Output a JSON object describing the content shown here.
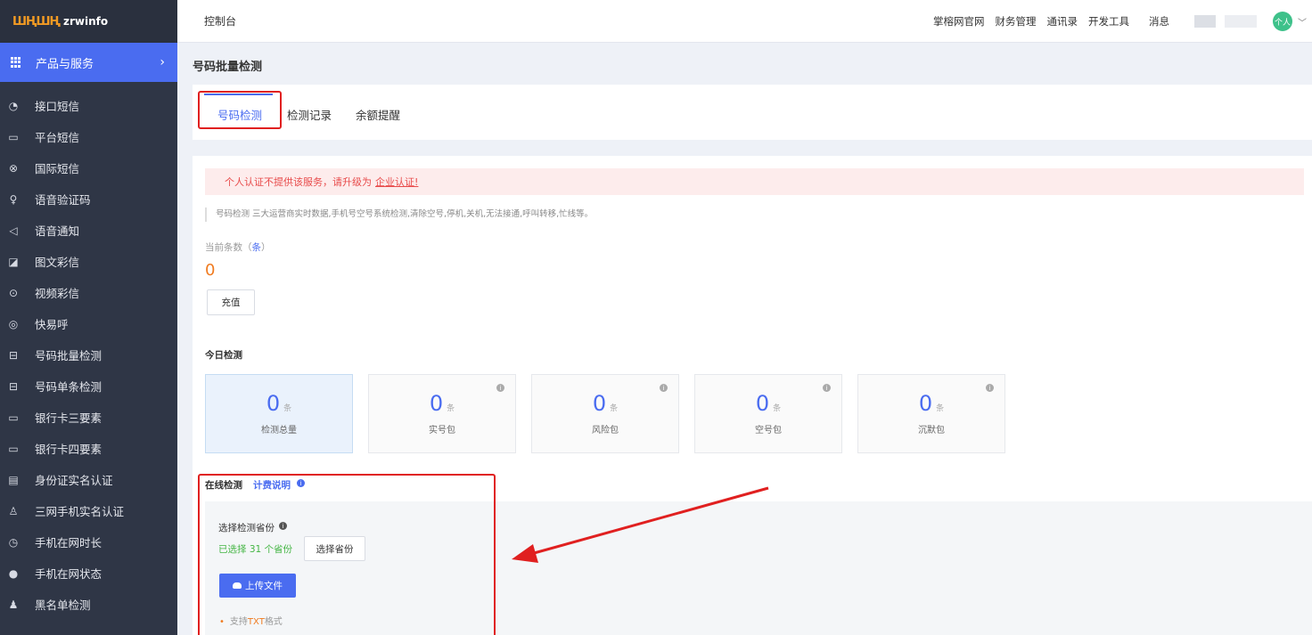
{
  "brand": {
    "mark": "ШҢШҢ",
    "name": "zrwinfo"
  },
  "sidebar": {
    "product_label": "产品与服务",
    "items": [
      {
        "label": "接口短信",
        "icon": "chat-bubble-icon"
      },
      {
        "label": "平台短信",
        "icon": "message-square-icon"
      },
      {
        "label": "国际短信",
        "icon": "globe-icon"
      },
      {
        "label": "语音验证码",
        "icon": "microphone-icon"
      },
      {
        "label": "语音通知",
        "icon": "speaker-icon"
      },
      {
        "label": "图文彩信",
        "icon": "image-chart-icon"
      },
      {
        "label": "视频彩信",
        "icon": "play-circle-icon"
      },
      {
        "label": "快易呼",
        "icon": "compass-icon"
      },
      {
        "label": "号码批量检测",
        "icon": "batch-check-icon"
      },
      {
        "label": "号码单条检测",
        "icon": "single-check-icon"
      },
      {
        "label": "银行卡三要素",
        "icon": "card-icon"
      },
      {
        "label": "银行卡四要素",
        "icon": "card-icon"
      },
      {
        "label": "身份证实名认证",
        "icon": "id-card-icon"
      },
      {
        "label": "三网手机实名认证",
        "icon": "user-icon"
      },
      {
        "label": "手机在网时长",
        "icon": "clock-icon"
      },
      {
        "label": "手机在网状态",
        "icon": "status-dot-icon"
      },
      {
        "label": "黑名单检测",
        "icon": "users-icon"
      }
    ]
  },
  "topbar": {
    "breadcrumb": "控制台",
    "nav": [
      "掌榕网官网",
      "财务管理",
      "通讯录",
      "开发工具"
    ],
    "message": "消息",
    "avatar": "个人"
  },
  "page": {
    "title": "号码批量检测",
    "tabs": [
      "号码检测",
      "检测记录",
      "余额提醒"
    ]
  },
  "alert": {
    "text": "个人认证不提供该服务，请升级为",
    "link": "企业认证!"
  },
  "description": "号码检测 三大运营商实时数据,手机号空号系统检测,清除空号,停机,关机,无法接通,呼叫转移,忙线等。",
  "balance": {
    "label": "当前条数（",
    "unit": "条",
    "close": "）",
    "value": "0",
    "recharge": "充值"
  },
  "today": {
    "title": "今日检测",
    "unit": "条",
    "stats": [
      {
        "value": "0",
        "label": "检测总量"
      },
      {
        "value": "0",
        "label": "实号包"
      },
      {
        "value": "0",
        "label": "风险包"
      },
      {
        "value": "0",
        "label": "空号包"
      },
      {
        "value": "0",
        "label": "沉默包"
      }
    ]
  },
  "online": {
    "title": "在线检测",
    "billing": "计费说明",
    "province_label": "选择检测省份",
    "province_selected": "已选择 31 个省份",
    "province_button": "选择省份",
    "upload": "上传文件",
    "support_prefix": "支持",
    "support_format": "TXT",
    "support_suffix": "格式"
  },
  "colors": {
    "accent": "#4a6cf0",
    "sidebar": "#2f3646",
    "highlight": "#e02020",
    "warning": "#f07b20",
    "success": "#43b543"
  }
}
